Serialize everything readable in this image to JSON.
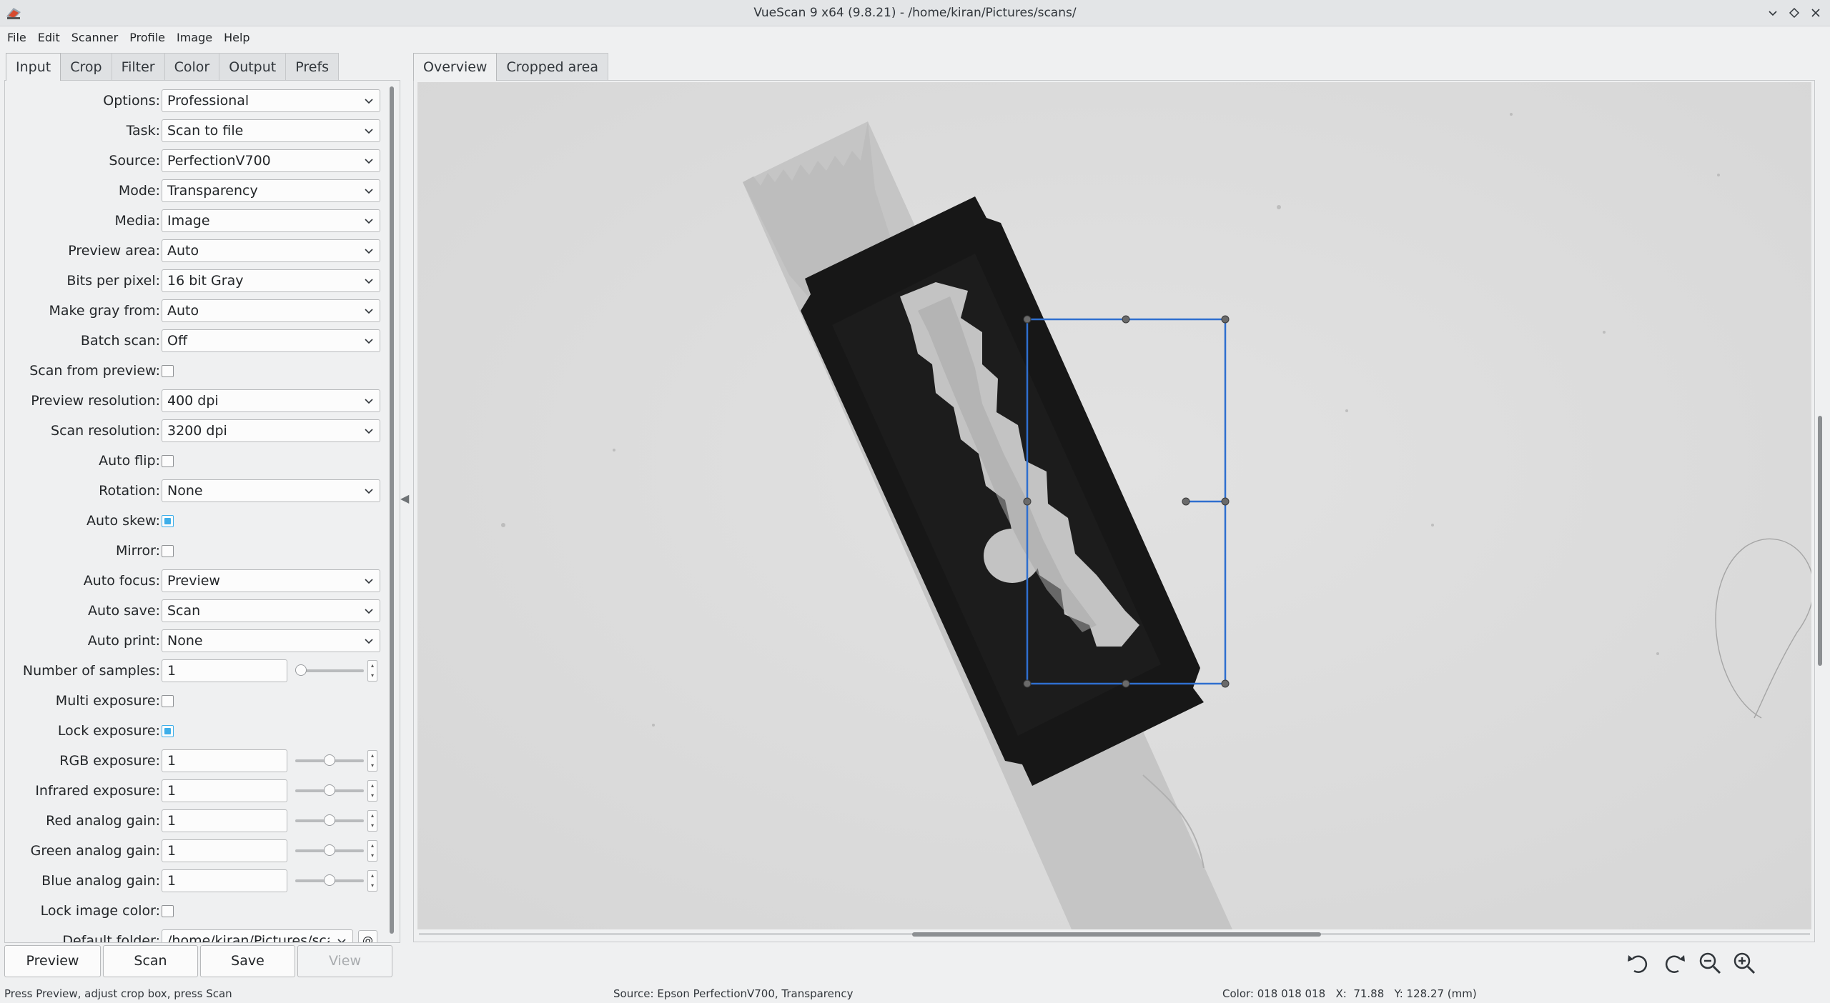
{
  "window": {
    "title": "VueScan 9 x64 (9.8.21) - /home/kiran/Pictures/scans/",
    "controls": [
      "chevron-down-icon",
      "restore-icon",
      "close-icon"
    ]
  },
  "menu": [
    "File",
    "Edit",
    "Scanner",
    "Profile",
    "Image",
    "Help"
  ],
  "left_tabs": [
    "Input",
    "Crop",
    "Filter",
    "Color",
    "Output",
    "Prefs"
  ],
  "left_active_tab": "Input",
  "settings": [
    {
      "label": "Options:",
      "type": "combo",
      "value": "Professional"
    },
    {
      "label": "Task:",
      "type": "combo",
      "value": "Scan to file"
    },
    {
      "label": "Source:",
      "type": "combo",
      "value": "PerfectionV700"
    },
    {
      "label": "Mode:",
      "type": "combo",
      "value": "Transparency"
    },
    {
      "label": "Media:",
      "type": "combo",
      "value": "Image"
    },
    {
      "label": "Preview area:",
      "type": "combo",
      "value": "Auto"
    },
    {
      "label": "Bits per pixel:",
      "type": "combo",
      "value": "16 bit Gray"
    },
    {
      "label": "Make gray from:",
      "type": "combo",
      "value": "Auto"
    },
    {
      "label": "Batch scan:",
      "type": "combo",
      "value": "Off"
    },
    {
      "label": "Scan from preview:",
      "type": "check",
      "checked": false
    },
    {
      "label": "Preview resolution:",
      "type": "combo",
      "value": "400 dpi"
    },
    {
      "label": "Scan resolution:",
      "type": "combo",
      "value": "3200 dpi"
    },
    {
      "label": "Auto flip:",
      "type": "check",
      "checked": false
    },
    {
      "label": "Rotation:",
      "type": "combo",
      "value": "None"
    },
    {
      "label": "Auto skew:",
      "type": "check",
      "checked": true
    },
    {
      "label": "Mirror:",
      "type": "check",
      "checked": false
    },
    {
      "label": "Auto focus:",
      "type": "combo",
      "value": "Preview"
    },
    {
      "label": "Auto save:",
      "type": "combo",
      "value": "Scan"
    },
    {
      "label": "Auto print:",
      "type": "combo",
      "value": "None"
    },
    {
      "label": "Number of samples:",
      "type": "spin",
      "value": "1",
      "slider_fraction": 0.0
    },
    {
      "label": "Multi exposure:",
      "type": "check",
      "checked": false
    },
    {
      "label": "Lock exposure:",
      "type": "check",
      "checked": true
    },
    {
      "label": "RGB exposure:",
      "type": "spin",
      "value": "1",
      "slider_fraction": 0.5
    },
    {
      "label": "Infrared exposure:",
      "type": "spin",
      "value": "1",
      "slider_fraction": 0.5
    },
    {
      "label": "Red analog gain:",
      "type": "spin",
      "value": "1",
      "slider_fraction": 0.5
    },
    {
      "label": "Green analog gain:",
      "type": "spin",
      "value": "1",
      "slider_fraction": 0.5
    },
    {
      "label": "Blue analog gain:",
      "type": "spin",
      "value": "1",
      "slider_fraction": 0.5
    },
    {
      "label": "Lock image color:",
      "type": "check",
      "checked": false
    },
    {
      "label": "Default folder:",
      "type": "folder",
      "value": "/home/kiran/Pictures/scar"
    }
  ],
  "buttons": {
    "preview": "Preview",
    "scan": "Scan",
    "save": "Save",
    "view": "View"
  },
  "right_tabs": [
    "Overview",
    "Cropped area"
  ],
  "right_active_tab": "Overview",
  "toolbar_icons": [
    "rotate-left-icon",
    "rotate-right-icon",
    "zoom-out-icon",
    "zoom-in-icon"
  ],
  "status": {
    "hint": "Press Preview, adjust crop box, press Scan",
    "source": "Source: Epson PerfectionV700, Transparency",
    "readout": "Color: 018 018 018   X:  71.88   Y: 128.27 (mm)"
  },
  "colors": {
    "accent": "#3daee9",
    "crop_box": "#2f6fcf",
    "window_bg": "#eff0f1"
  }
}
